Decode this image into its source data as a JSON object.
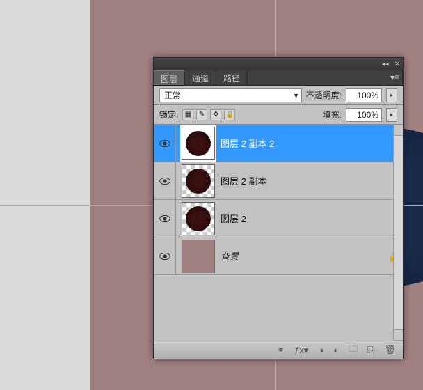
{
  "tabs": {
    "layers": "图层",
    "channels": "通道",
    "paths": "路径"
  },
  "blend": {
    "mode": "正常",
    "opacity_label": "不透明度:",
    "opacity_value": "100%",
    "fill_label": "填充:",
    "fill_value": "100%",
    "lock_label": "锁定:"
  },
  "layers": [
    {
      "name": "图层 2 副本 2",
      "selected": true,
      "visible": true,
      "checker": false
    },
    {
      "name": "图层 2 副本",
      "selected": false,
      "visible": true,
      "checker": true
    },
    {
      "name": "图层 2",
      "selected": false,
      "visible": true,
      "checker": true
    },
    {
      "name": "背景",
      "selected": false,
      "visible": true,
      "bg": true,
      "locked": true
    }
  ],
  "chart_data": null
}
